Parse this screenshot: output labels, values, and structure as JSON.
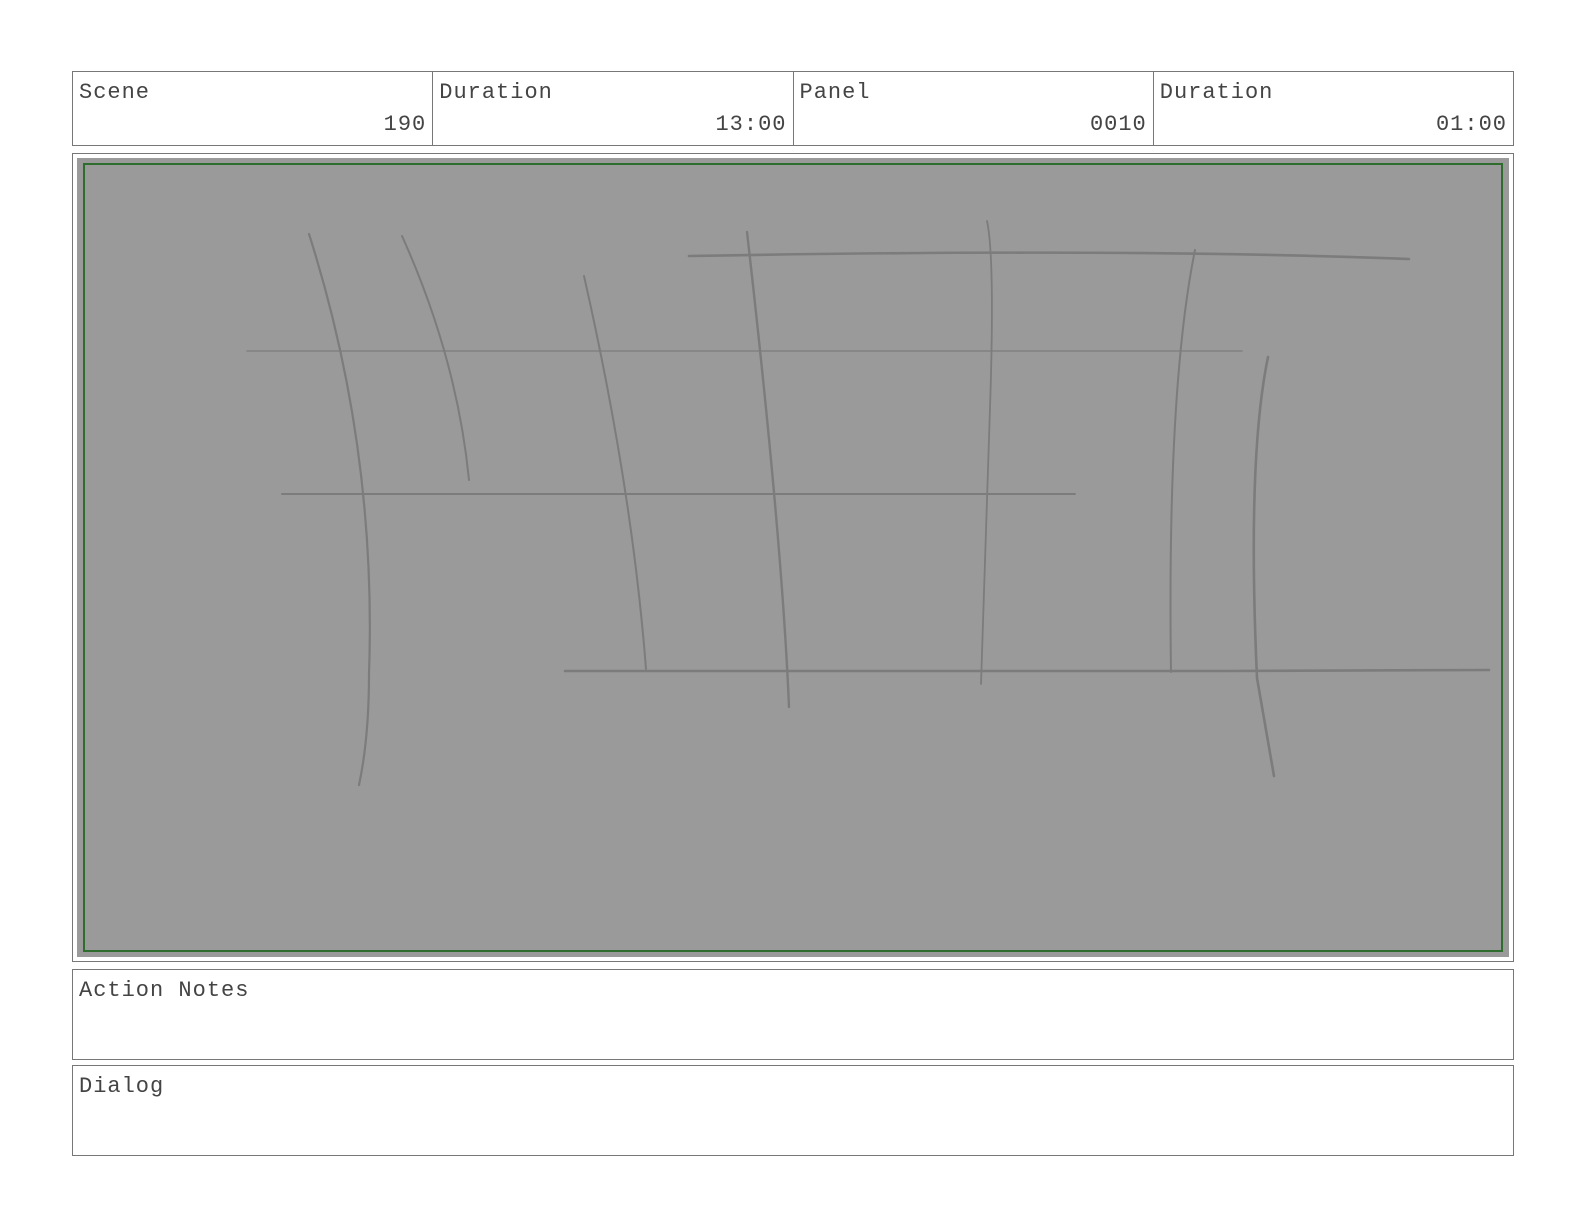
{
  "header": {
    "scene_label": "Scene",
    "scene_value": "190",
    "scene_duration_label": "Duration",
    "scene_duration_value": "13:00",
    "panel_label": "Panel",
    "panel_value": "0010",
    "panel_duration_label": "Duration",
    "panel_duration_value": "01:00"
  },
  "panel": {
    "background_color": "#9a9a9a",
    "safe_area_color": "#2f6d2f",
    "sketch_color": "#7c7c7c"
  },
  "notes": {
    "action_label": "Action Notes",
    "action_text": "",
    "dialog_label": "Dialog",
    "dialog_text": ""
  }
}
